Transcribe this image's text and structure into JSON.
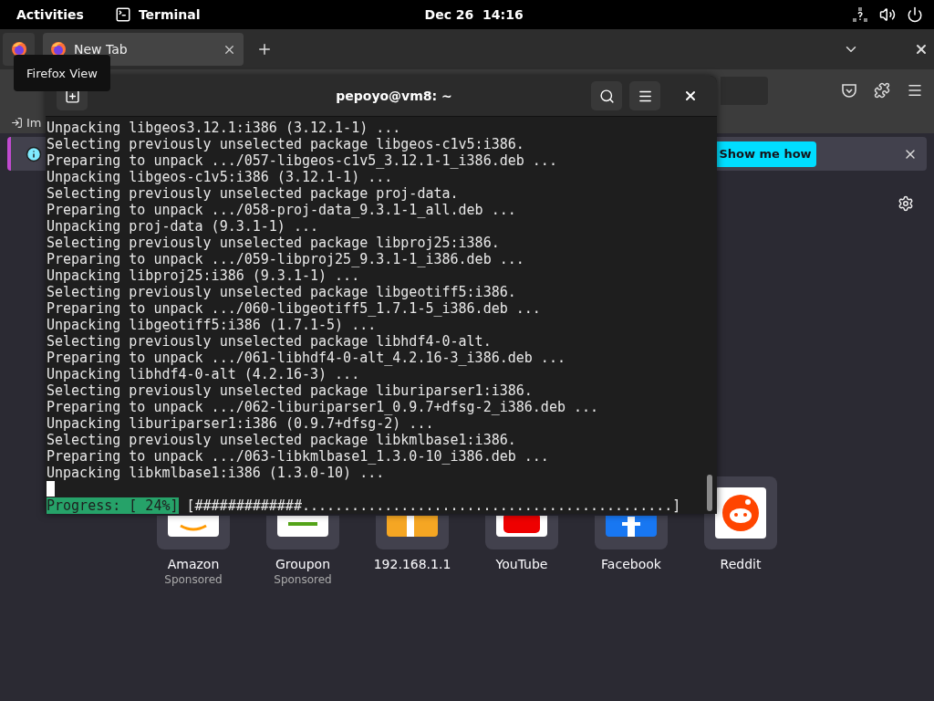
{
  "top_bar": {
    "activities": "Activities",
    "app": "Terminal",
    "clock": "Dec 26  14:16"
  },
  "firefox": {
    "tooltip": "Firefox View",
    "tabs": [
      {
        "label": "New Tab",
        "selected": true
      }
    ],
    "bookmarks": [
      {
        "label": "Im"
      }
    ],
    "notification": {
      "button": "Show me how"
    },
    "shortcuts": [
      {
        "label": "Amazon",
        "sponsor": "Sponsored",
        "kind": "amazon"
      },
      {
        "label": "Groupon",
        "sponsor": "Sponsored",
        "kind": "groupon"
      },
      {
        "label": "192.168.1.1",
        "kind": "generic"
      },
      {
        "label": "YouTube",
        "kind": "youtube"
      },
      {
        "label": "Facebook",
        "kind": "facebook"
      },
      {
        "label": "Reddit",
        "kind": "reddit"
      }
    ]
  },
  "terminal": {
    "title": "pepoyo@vm8: ~",
    "lines": [
      "Unpacking libgeos3.12.1:i386 (3.12.1-1) ...",
      "Selecting previously unselected package libgeos-c1v5:i386.",
      "Preparing to unpack .../057-libgeos-c1v5_3.12.1-1_i386.deb ...",
      "Unpacking libgeos-c1v5:i386 (3.12.1-1) ...",
      "Selecting previously unselected package proj-data.",
      "Preparing to unpack .../058-proj-data_9.3.1-1_all.deb ...",
      "Unpacking proj-data (9.3.1-1) ...",
      "Selecting previously unselected package libproj25:i386.",
      "Preparing to unpack .../059-libproj25_9.3.1-1_i386.deb ...",
      "Unpacking libproj25:i386 (9.3.1-1) ...",
      "Selecting previously unselected package libgeotiff5:i386.",
      "Preparing to unpack .../060-libgeotiff5_1.7.1-5_i386.deb ...",
      "Unpacking libgeotiff5:i386 (1.7.1-5) ...",
      "Selecting previously unselected package libhdf4-0-alt.",
      "Preparing to unpack .../061-libhdf4-0-alt_4.2.16-3_i386.deb ...",
      "Unpacking libhdf4-0-alt (4.2.16-3) ...",
      "Selecting previously unselected package liburiparser1:i386.",
      "Preparing to unpack .../062-liburiparser1_0.9.7+dfsg-2_i386.deb ...",
      "Unpacking liburiparser1:i386 (0.9.7+dfsg-2) ...",
      "Selecting previously unselected package libkmlbase1:i386.",
      "Preparing to unpack .../063-libkmlbase1_1.3.0-10_i386.deb ...",
      "Unpacking libkmlbase1:i386 (1.3.0-10) ..."
    ],
    "progress": {
      "label": "Progress: [ 24%]",
      "bar": "[#############.............................................]"
    }
  }
}
